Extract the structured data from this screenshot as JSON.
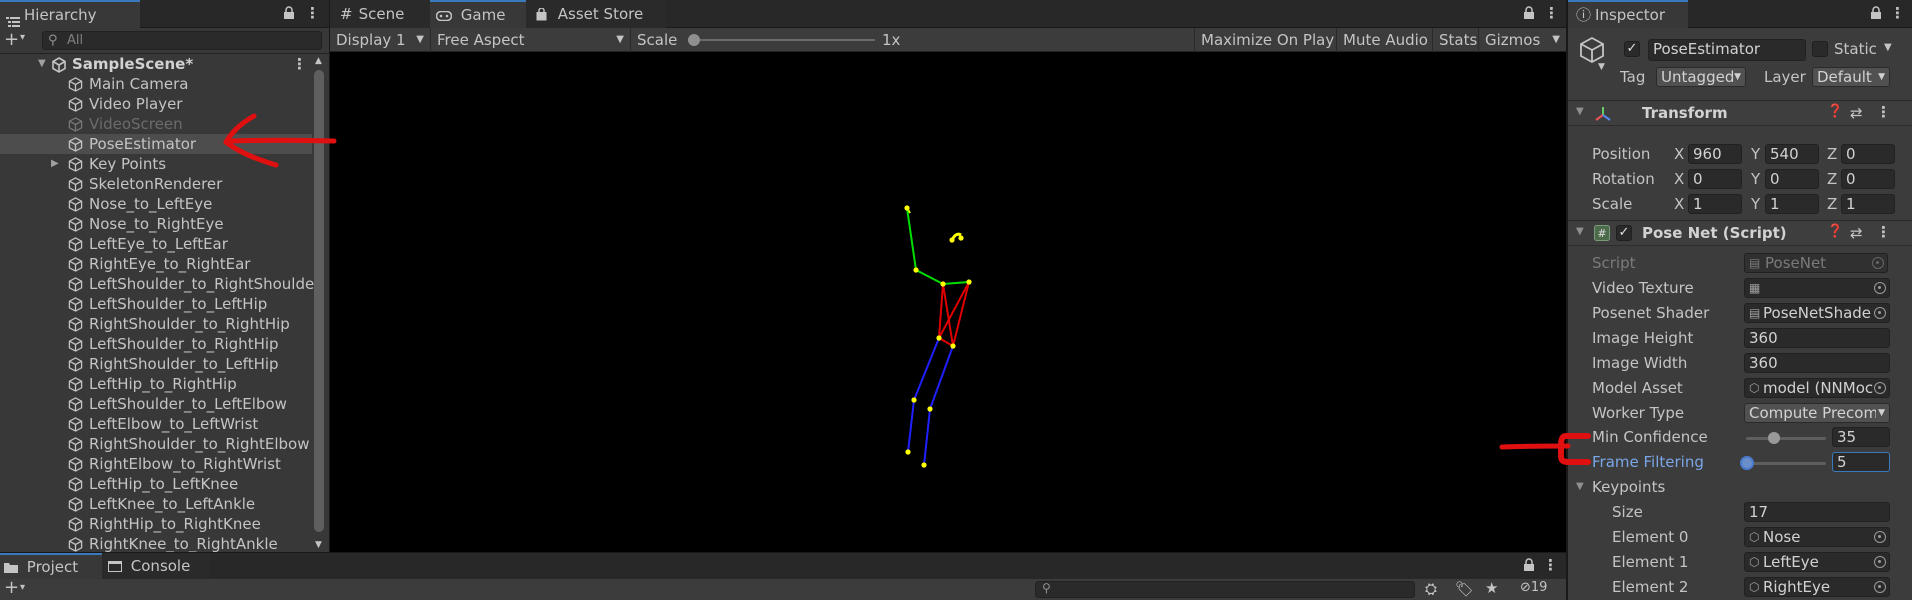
{
  "hierarchy": {
    "tab_label": "Hierarchy",
    "search_placeholder": "All",
    "scene_name": "SampleScene*",
    "items": [
      {
        "label": "Main Camera"
      },
      {
        "label": "Video Player"
      },
      {
        "label": "VideoScreen"
      },
      {
        "label": "PoseEstimator"
      },
      {
        "label": "Key Points"
      },
      {
        "label": "SkeletonRenderer"
      },
      {
        "label": "Nose_to_LeftEye"
      },
      {
        "label": "Nose_to_RightEye"
      },
      {
        "label": "LeftEye_to_LeftEar"
      },
      {
        "label": "RightEye_to_RightEar"
      },
      {
        "label": "LeftShoulder_to_RightShoulder"
      },
      {
        "label": "LeftShoulder_to_LeftHip"
      },
      {
        "label": "RightShoulder_to_RightHip"
      },
      {
        "label": "LeftShoulder_to_RightHip"
      },
      {
        "label": "RightShoulder_to_LeftHip"
      },
      {
        "label": "LeftHip_to_RightHip"
      },
      {
        "label": "LeftShoulder_to_LeftElbow"
      },
      {
        "label": "LeftElbow_to_LeftWrist"
      },
      {
        "label": "RightShoulder_to_RightElbow"
      },
      {
        "label": "RightElbow_to_RightWrist"
      },
      {
        "label": "LeftHip_to_LeftKnee"
      },
      {
        "label": "LeftKnee_to_LeftAnkle"
      },
      {
        "label": "RightHip_to_RightKnee"
      },
      {
        "label": "RightKnee_to_RightAnkle"
      }
    ],
    "disabled_item": "VideoScreen",
    "selected_item": "PoseEstimator"
  },
  "game": {
    "tabs": [
      {
        "label": "Scene"
      },
      {
        "label": "Game"
      },
      {
        "label": "Asset Store"
      }
    ],
    "display": "Display 1",
    "aspect": "Free Aspect",
    "scale_label": "Scale",
    "scale_value": "1x",
    "buttons": {
      "maximize": "Maximize On Play",
      "mute": "Mute Audio",
      "stats": "Stats",
      "gizmos": "Gizmos"
    }
  },
  "inspector": {
    "tab_label": "Inspector",
    "object_name": "PoseEstimator",
    "static_label": "Static",
    "tag_label": "Tag",
    "tag_value": "Untagged",
    "layer_label": "Layer",
    "layer_value": "Default",
    "transform": {
      "title": "Transform",
      "position_label": "Position",
      "rotation_label": "Rotation",
      "scale_label": "Scale",
      "position": {
        "x": "960",
        "y": "540",
        "z": "0"
      },
      "rotation": {
        "x": "0",
        "y": "0",
        "z": "0"
      },
      "scale": {
        "x": "1",
        "y": "1",
        "z": "1"
      },
      "axis_x": "X",
      "axis_y": "Y",
      "axis_z": "Z"
    },
    "posenet": {
      "title": "Pose Net (Script)",
      "script_label": "Script",
      "script_value": "PoseNet",
      "video_texture_label": "Video Texture",
      "posenet_shader_label": "Posenet Shader",
      "posenet_shader_value": "PoseNetShade",
      "image_height_label": "Image Height",
      "image_height_value": "360",
      "image_width_label": "Image Width",
      "image_width_value": "360",
      "model_asset_label": "Model Asset",
      "model_asset_value": "model (NNMoc",
      "worker_type_label": "Worker Type",
      "worker_type_value": "Compute Precom",
      "min_confidence_label": "Min Confidence",
      "min_confidence_value": "35",
      "min_confidence_fraction": 0.35,
      "frame_filtering_label": "Frame Filtering",
      "frame_filtering_value": "5",
      "frame_filtering_fraction": 0.0,
      "keypoints_label": "Keypoints",
      "size_label": "Size",
      "size_value": "17",
      "elements": [
        {
          "label": "Element 0",
          "value": "Nose"
        },
        {
          "label": "Element 1",
          "value": "LeftEye"
        },
        {
          "label": "Element 2",
          "value": "RightEye"
        }
      ]
    }
  },
  "project": {
    "tabs": [
      {
        "label": "Project"
      },
      {
        "label": "Console"
      }
    ],
    "hidden_count": "19"
  },
  "colors": {
    "accent_blue": "#3a79bb",
    "selected_row": "#4d4d4d",
    "annotation_red": "#e01010",
    "skeleton_head": "#00e000",
    "skeleton_torso": "#e00000",
    "skeleton_legs": "#1a1aff",
    "keypoint": "#ffff00"
  }
}
